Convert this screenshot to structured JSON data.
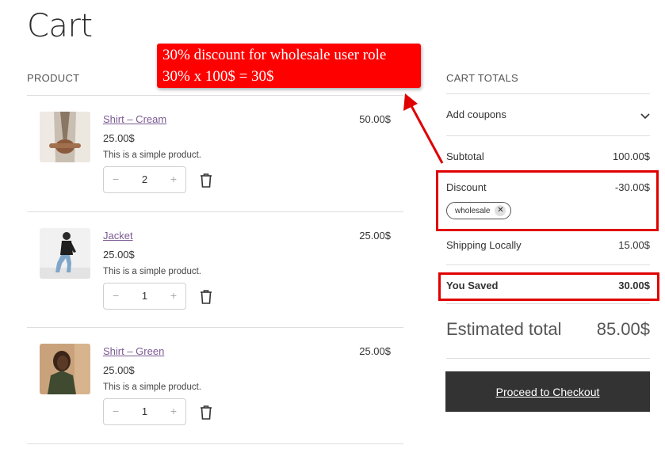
{
  "page": {
    "title": "Cart"
  },
  "columns": {
    "product": "PRODUCT",
    "cart_totals": "CART TOTALS"
  },
  "products": [
    {
      "name": "Shirt – Cream",
      "price": "25.00$",
      "description": "This is a simple product.",
      "quantity": "2",
      "line_total": "50.00$"
    },
    {
      "name": "Jacket",
      "price": "25.00$",
      "description": "This is a simple product.",
      "quantity": "1",
      "line_total": "25.00$"
    },
    {
      "name": "Shirt – Green",
      "price": "25.00$",
      "description": "This is a simple product.",
      "quantity": "1",
      "line_total": "25.00$"
    }
  ],
  "qty_controls": {
    "minus": "−",
    "plus": "+"
  },
  "totals": {
    "add_coupons": "Add coupons",
    "subtotal_label": "Subtotal",
    "subtotal_value": "100.00$",
    "discount_label": "Discount",
    "discount_value": "-30.00$",
    "coupon_code": "wholesale",
    "coupon_remove": "✕",
    "shipping_label": "Shipping Locally",
    "shipping_value": "15.00$",
    "saved_label": "You Saved",
    "saved_value": "30.00$",
    "estimated_label": "Estimated total",
    "estimated_value": "85.00$",
    "checkout_label": "Proceed to Checkout"
  },
  "annotation": {
    "line1": "30% discount for wholesale user role",
    "line2": "30% x 100$ = 30$"
  },
  "colors": {
    "highlight": "#e00000",
    "callout_bg": "#ff0000",
    "button_bg": "#333333",
    "link": "#7b5a93"
  }
}
